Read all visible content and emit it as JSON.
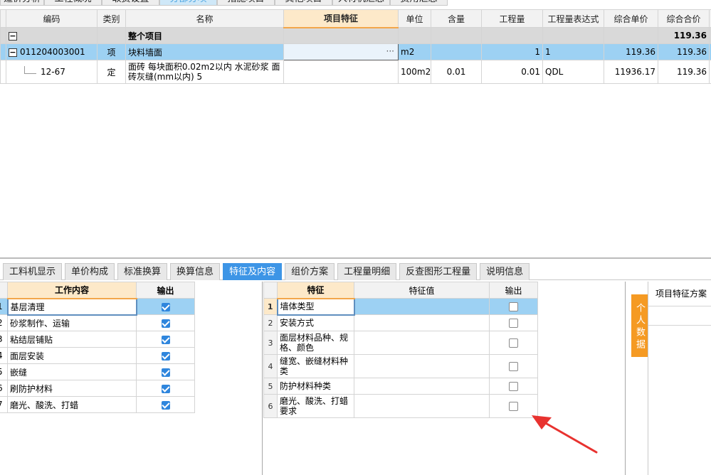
{
  "top_tabs": [
    {
      "label": "造价分析",
      "active": false
    },
    {
      "label": "工程概况",
      "active": false
    },
    {
      "label": "取费设置",
      "active": false
    },
    {
      "label": "分部分项",
      "active": true
    },
    {
      "label": "措施项目",
      "active": false
    },
    {
      "label": "其他项目",
      "active": false
    },
    {
      "label": "人材机汇总",
      "active": false
    },
    {
      "label": "费用汇总",
      "active": false
    }
  ],
  "main_grid": {
    "headers": [
      "编码",
      "类别",
      "名称",
      "项目特征",
      "单位",
      "含量",
      "工程量",
      "工程量表达式",
      "综合单价",
      "综合合价"
    ],
    "total_row": {
      "toggle": "−",
      "name": "整个项目",
      "amount": "119.36"
    },
    "item_row": {
      "toggle": "−",
      "code": "011204003001",
      "type": "项",
      "name": "块料墙面",
      "feature_ellipsis": "···",
      "unit": "m2",
      "content": "",
      "qty": "1",
      "expr": "1",
      "unit_price": "119.36",
      "amount": "119.36"
    },
    "sub_row": {
      "code": "12-67",
      "type": "定",
      "name": "面砖 每块面积0.02m2以内 水泥砂浆 面砖灰缝(mm以内) 5",
      "unit": "100m2",
      "content": "0.01",
      "qty": "0.01",
      "expr": "QDL",
      "unit_price": "11936.17",
      "amount": "119.36"
    }
  },
  "bottom_tabs": [
    {
      "label": "工料机显示",
      "active": false
    },
    {
      "label": "单价构成",
      "active": false
    },
    {
      "label": "标准换算",
      "active": false
    },
    {
      "label": "换算信息",
      "active": false
    },
    {
      "label": "特征及内容",
      "active": true
    },
    {
      "label": "组价方案",
      "active": false
    },
    {
      "label": "工程量明细",
      "active": false
    },
    {
      "label": "反查图形工程量",
      "active": false
    },
    {
      "label": "说明信息",
      "active": false
    }
  ],
  "work_content": {
    "headers": [
      "工作内容",
      "输出"
    ],
    "rows": [
      {
        "index": "1",
        "name": "基层清理",
        "output": true
      },
      {
        "index": "2",
        "name": "砂浆制作、运输",
        "output": true
      },
      {
        "index": "3",
        "name": "粘结层铺贴",
        "output": true
      },
      {
        "index": "4",
        "name": "面层安装",
        "output": true
      },
      {
        "index": "5",
        "name": "嵌缝",
        "output": true
      },
      {
        "index": "6",
        "name": "刷防护材料",
        "output": true
      },
      {
        "index": "7",
        "name": "磨光、酸洗、打蜡",
        "output": true
      }
    ]
  },
  "features": {
    "headers": [
      "特征",
      "特征值",
      "输出"
    ],
    "rows": [
      {
        "index": "1",
        "name": "墙体类型",
        "value": "",
        "output": false
      },
      {
        "index": "2",
        "name": "安装方式",
        "value": "",
        "output": false
      },
      {
        "index": "3",
        "name": "面层材料品种、规格、颜色",
        "value": "",
        "output": false
      },
      {
        "index": "4",
        "name": "缝宽、嵌缝材料种类",
        "value": "",
        "output": false
      },
      {
        "index": "5",
        "name": "防护材料种类",
        "value": "",
        "output": false
      },
      {
        "index": "6",
        "name": "磨光、酸洗、打蜡要求",
        "value": "",
        "output": false
      }
    ]
  },
  "side": {
    "tab_label": "个人数据",
    "panel_title": "项目特征方案"
  },
  "colors": {
    "accent": "#3d95e6",
    "selected_row": "#9dd1f3",
    "header_highlight": "#fde9c9",
    "side_tab": "#f59a23",
    "arrow": "#e8322f"
  }
}
